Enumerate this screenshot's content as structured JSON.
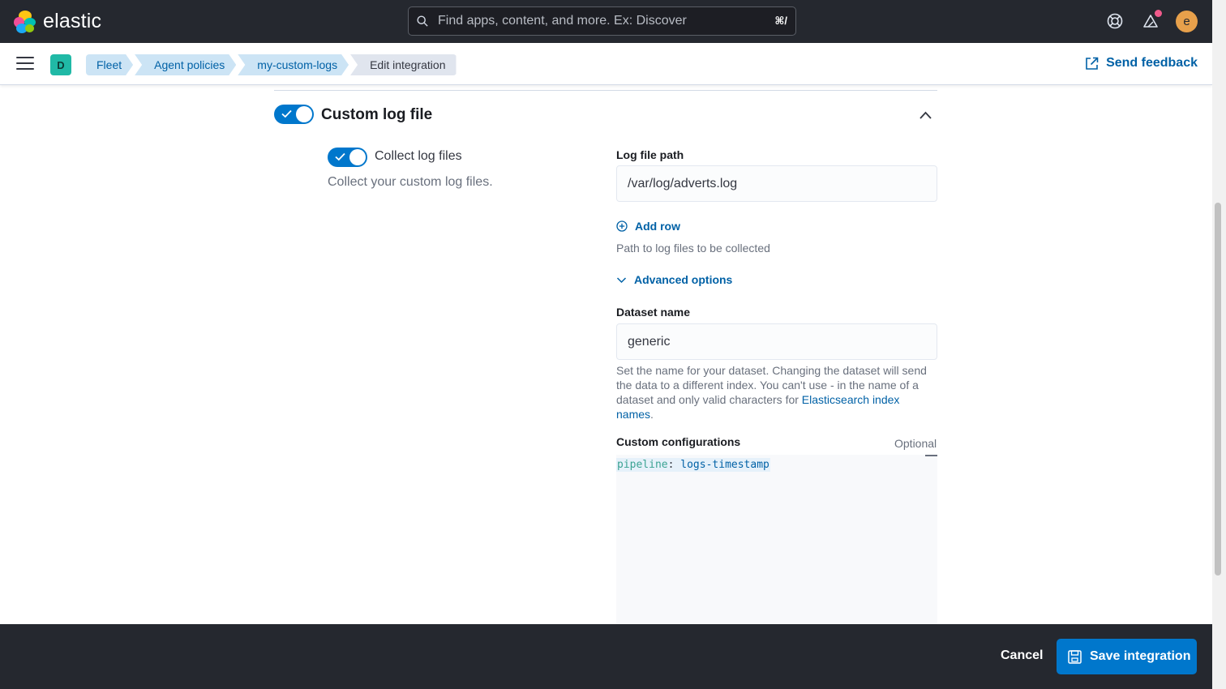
{
  "header": {
    "logo_text": "elastic",
    "search_placeholder": "Find apps, content, and more. Ex: Discover",
    "search_shortcut": "⌘/",
    "user_initial": "e"
  },
  "subheader": {
    "space_initial": "D",
    "breadcrumbs": [
      "Fleet",
      "Agent policies",
      "my-custom-logs",
      "Edit integration"
    ],
    "feedback_label": "Send feedback"
  },
  "section": {
    "title": "Custom log file",
    "enabled": true,
    "collect": {
      "label": "Collect log files",
      "enabled": true,
      "description": "Collect your custom log files."
    }
  },
  "fields": {
    "log_path": {
      "label": "Log file path",
      "value": "/var/log/adverts.log",
      "add_row": "Add row",
      "help": "Path to log files to be collected"
    },
    "advanced_options": "Advanced options",
    "dataset": {
      "label": "Dataset name",
      "value": "generic",
      "help_text": "Set the name for your dataset. Changing the dataset will send the data to a different index. You can't use - in the name of a dataset and only valid characters for",
      "help_link": "Elasticsearch index names",
      "help_end": "."
    },
    "custom_config": {
      "label": "Custom configurations",
      "optional": "Optional",
      "code_key": "pipeline",
      "code_sep": ": ",
      "code_value": "logs-timestamp"
    }
  },
  "footer": {
    "cancel_label": "Cancel",
    "save_label": "Save integration"
  },
  "colors": {
    "primary": "#0077cc",
    "header_bg": "#25282f",
    "link": "#0061a6"
  }
}
